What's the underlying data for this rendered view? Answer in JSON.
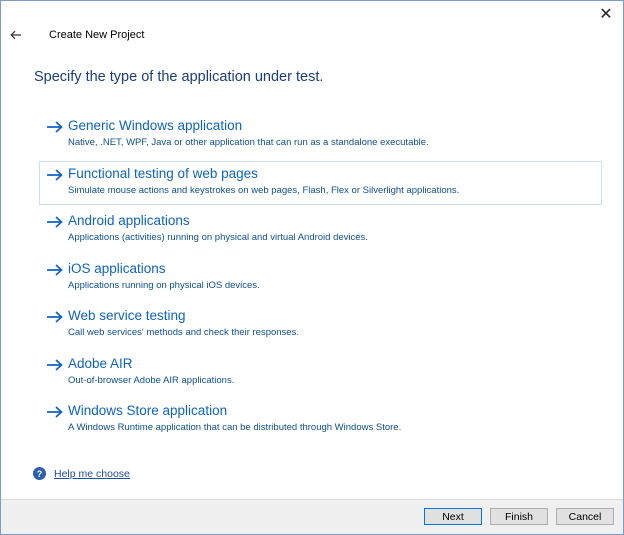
{
  "window": {
    "title": "Create New Project",
    "close_glyph": "✕"
  },
  "heading": "Specify the type of the application under test.",
  "options": [
    {
      "title": "Generic Windows application",
      "description": "Native, .NET, WPF, Java or other application that can run as a standalone executable.",
      "icon": "arrow-right-icon"
    },
    {
      "title": "Functional testing of web pages",
      "description": "Simulate mouse actions and keystrokes on web pages, Flash, Flex or Silverlight applications.",
      "icon": "arrow-right-icon",
      "selected": true
    },
    {
      "title": "Android applications",
      "description": "Applications (activities) running on physical and virtual Android devices.",
      "icon": "arrow-right-icon"
    },
    {
      "title": "iOS applications",
      "description": "Applications running on physical iOS devices.",
      "icon": "arrow-right-icon"
    },
    {
      "title": "Web service testing",
      "description": "Call web services' methods and check their responses.",
      "icon": "arrow-right-icon"
    },
    {
      "title": "Adobe AIR",
      "description": "Out-of-browser Adobe AIR applications.",
      "icon": "arrow-right-icon"
    },
    {
      "title": "Windows Store application",
      "description": "A Windows Runtime application that can be distributed through Windows Store.",
      "icon": "arrow-right-icon"
    }
  ],
  "help": {
    "label": "Help me choose",
    "icon_glyph": "?"
  },
  "footer": {
    "next_label": "Next",
    "finish_label": "Finish",
    "cancel_label": "Cancel"
  },
  "colors": {
    "accent": "#0e63c3",
    "heading": "#1a3d7c",
    "selected_border": "#c9dff5"
  }
}
